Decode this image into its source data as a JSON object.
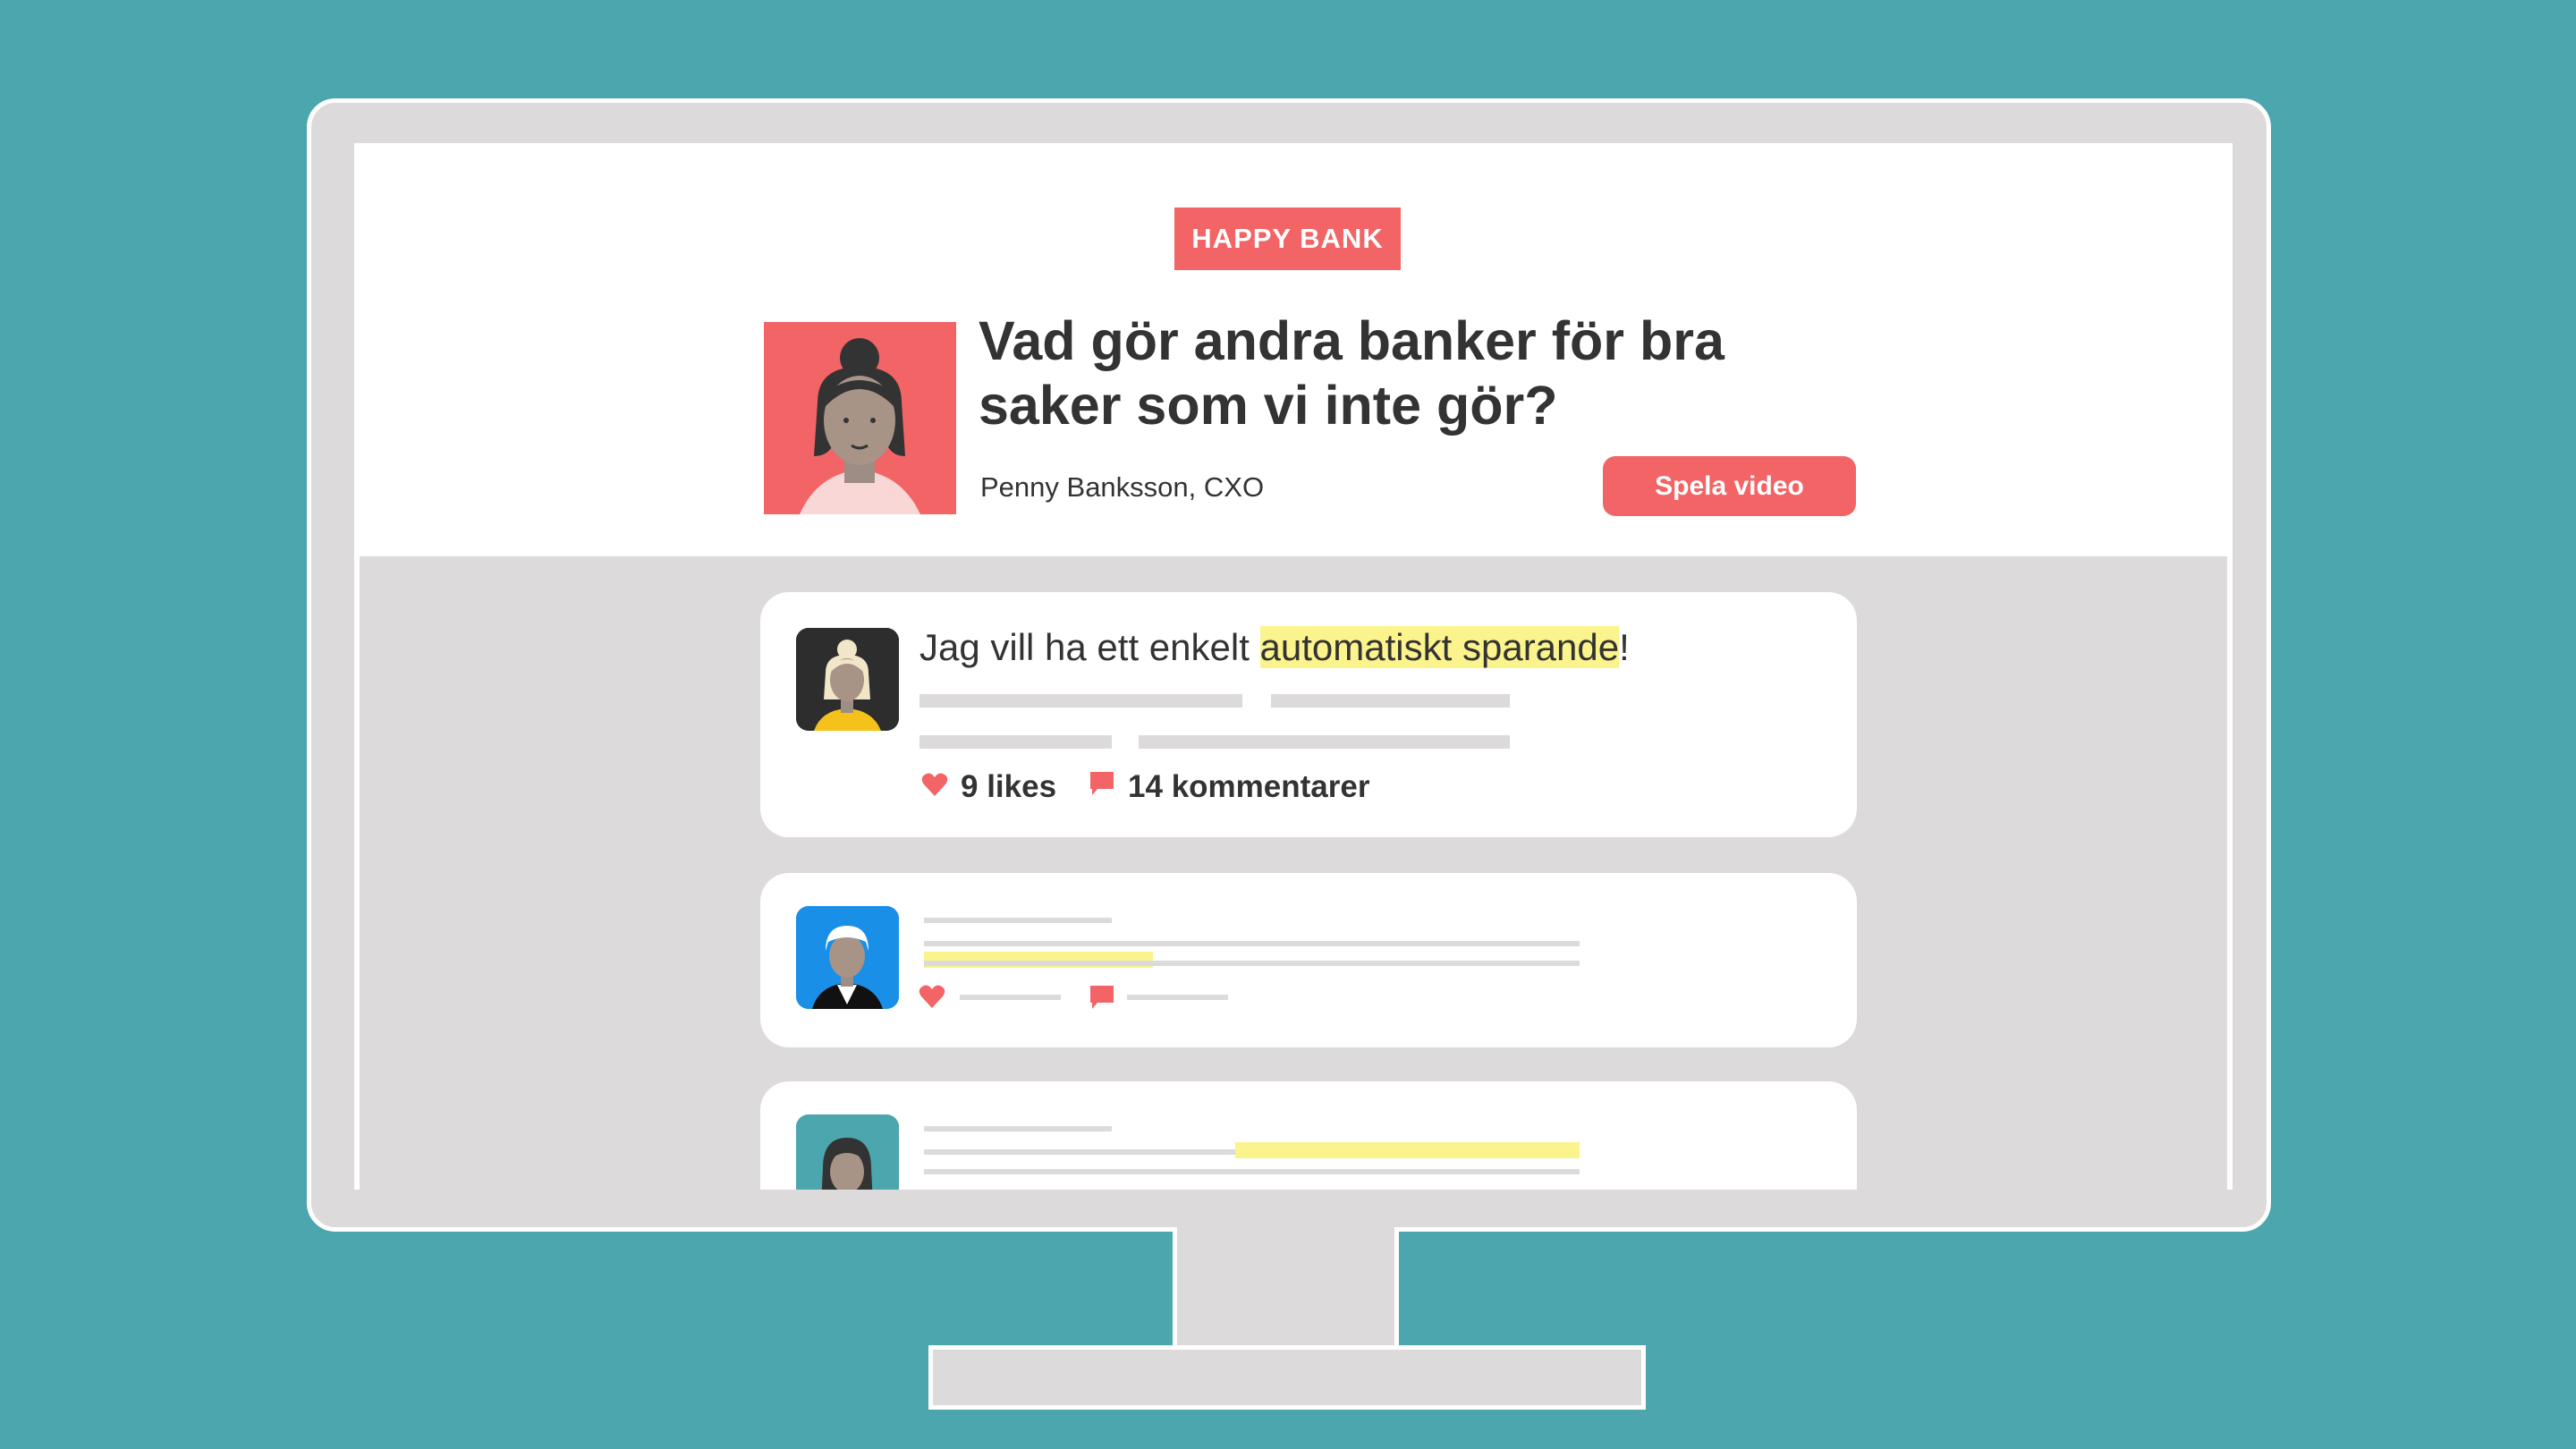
{
  "brand": {
    "label": "HAPPY BANK",
    "color": "#f26465"
  },
  "hero": {
    "headline": "Vad gör andra banker för bra saker som vi inte gör?",
    "byline": "Penny Banksson, CXO",
    "play_button": "Spela video"
  },
  "comments": [
    {
      "text_before": "Jag vill ha ett enkelt ",
      "text_highlight": "automatiskt sparande",
      "text_after": "!",
      "likes_label": "9 likes",
      "comments_label": "14 kommentarer"
    }
  ],
  "icons": {
    "like": "heart-icon",
    "comment": "speech-bubble-icon"
  },
  "colors": {
    "background": "#4ba6ad",
    "accent": "#f26465",
    "highlight": "#fbf38c"
  }
}
